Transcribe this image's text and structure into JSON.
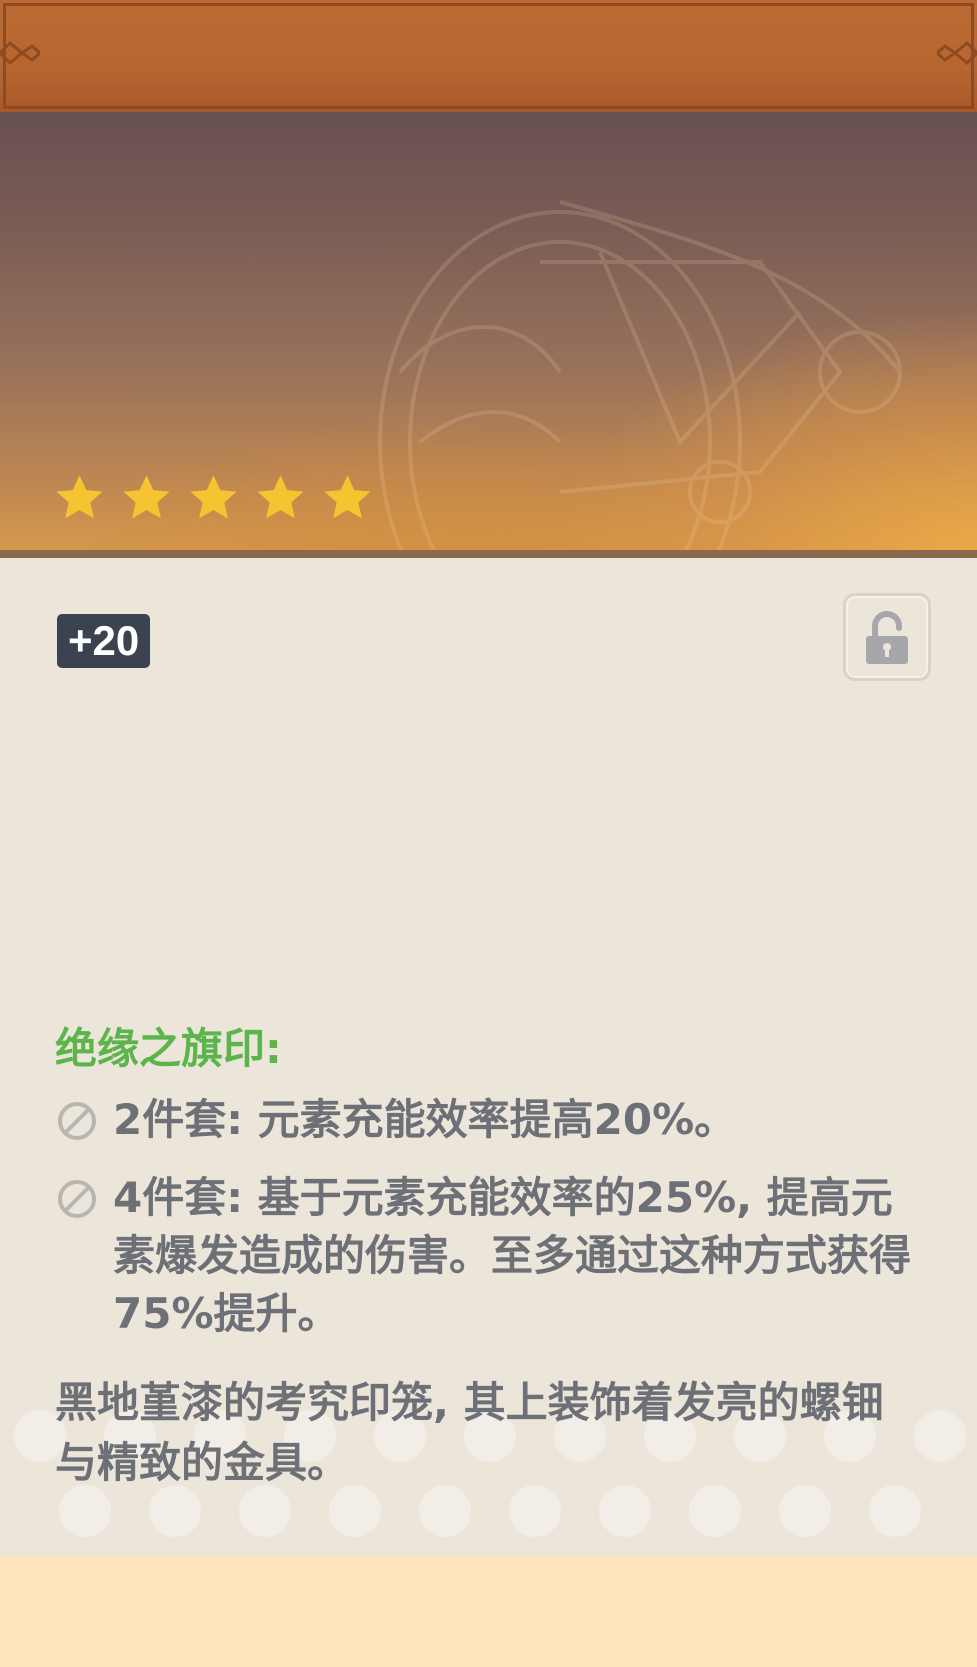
{
  "header": {
    "title": ""
  },
  "banner": {
    "rarity_stars": 5,
    "star_color": "#f7c431"
  },
  "artifact": {
    "level_label": "+20",
    "lock_icon": "unlocked-padlock-icon",
    "set_name": "绝缘之旗印:",
    "set_name_color": "#5cb54b",
    "effects": [
      {
        "icon": "disabled-circle-icon",
        "text": "2件套: 元素充能效率提高20%。"
      },
      {
        "icon": "disabled-circle-icon",
        "text": "4件套: 基于元素充能效率的25%, 提高元素爆发造成的伤害。至多通过这种方式获得75%提升。"
      }
    ],
    "description": "黑地堇漆的考究印笼, 其上装饰着发亮的螺钿与精致的金具。"
  },
  "colors": {
    "title_bar": "#b86630",
    "body_background": "#ece5da",
    "footer_background": "#ffe5bc",
    "badge_background": "#3c4350",
    "body_text": "#6e7078"
  }
}
